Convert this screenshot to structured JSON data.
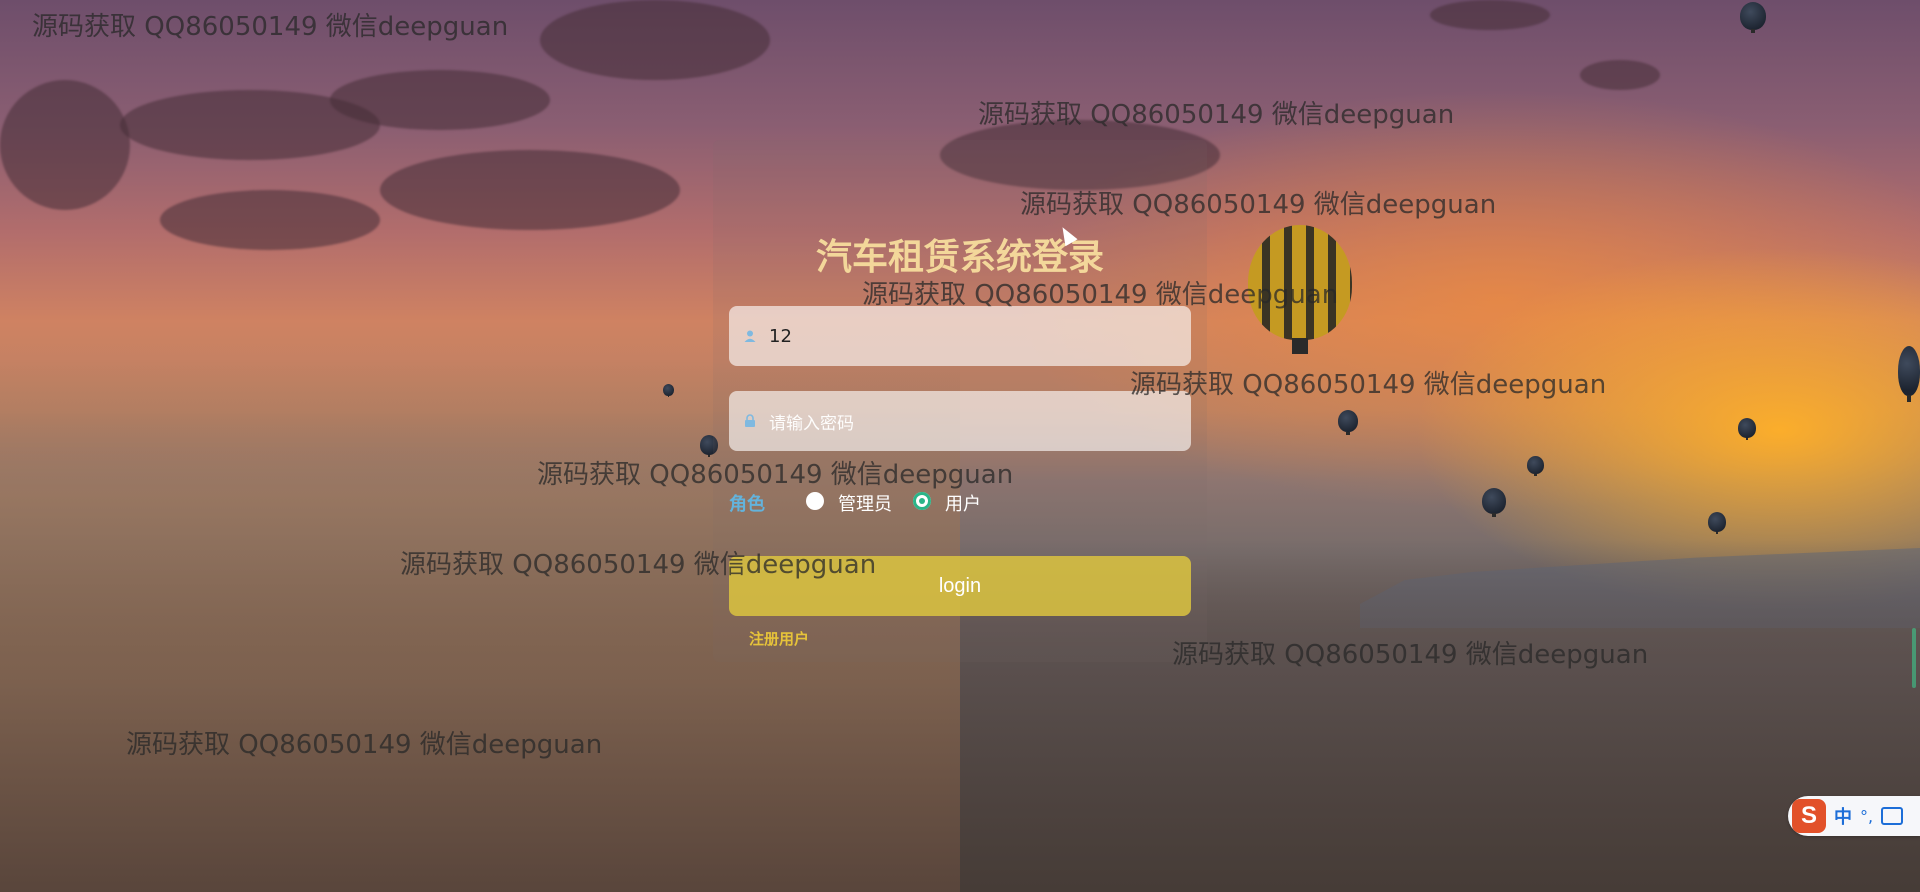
{
  "watermark_text": "源码获取 QQ86050149 微信deepguan",
  "title": "汽车租赁系统登录",
  "username": {
    "value": "12",
    "icon": "user-icon"
  },
  "password": {
    "placeholder": "请输入密码",
    "icon": "lock-icon"
  },
  "role": {
    "label": "角色",
    "options": [
      {
        "label": "管理员",
        "checked": false
      },
      {
        "label": "用户",
        "checked": true
      }
    ]
  },
  "login_button": "login",
  "register_link": "注册用户",
  "ime": {
    "logo": "S",
    "mode": "中",
    "punct": "°,",
    "icon": "keyboard-icon"
  },
  "colors": {
    "title": "#f3d79a",
    "role_label": "#63b3dc",
    "radio_checked": "#2bb488",
    "login_button": "#dcc440",
    "register_link": "#e6c33a"
  }
}
